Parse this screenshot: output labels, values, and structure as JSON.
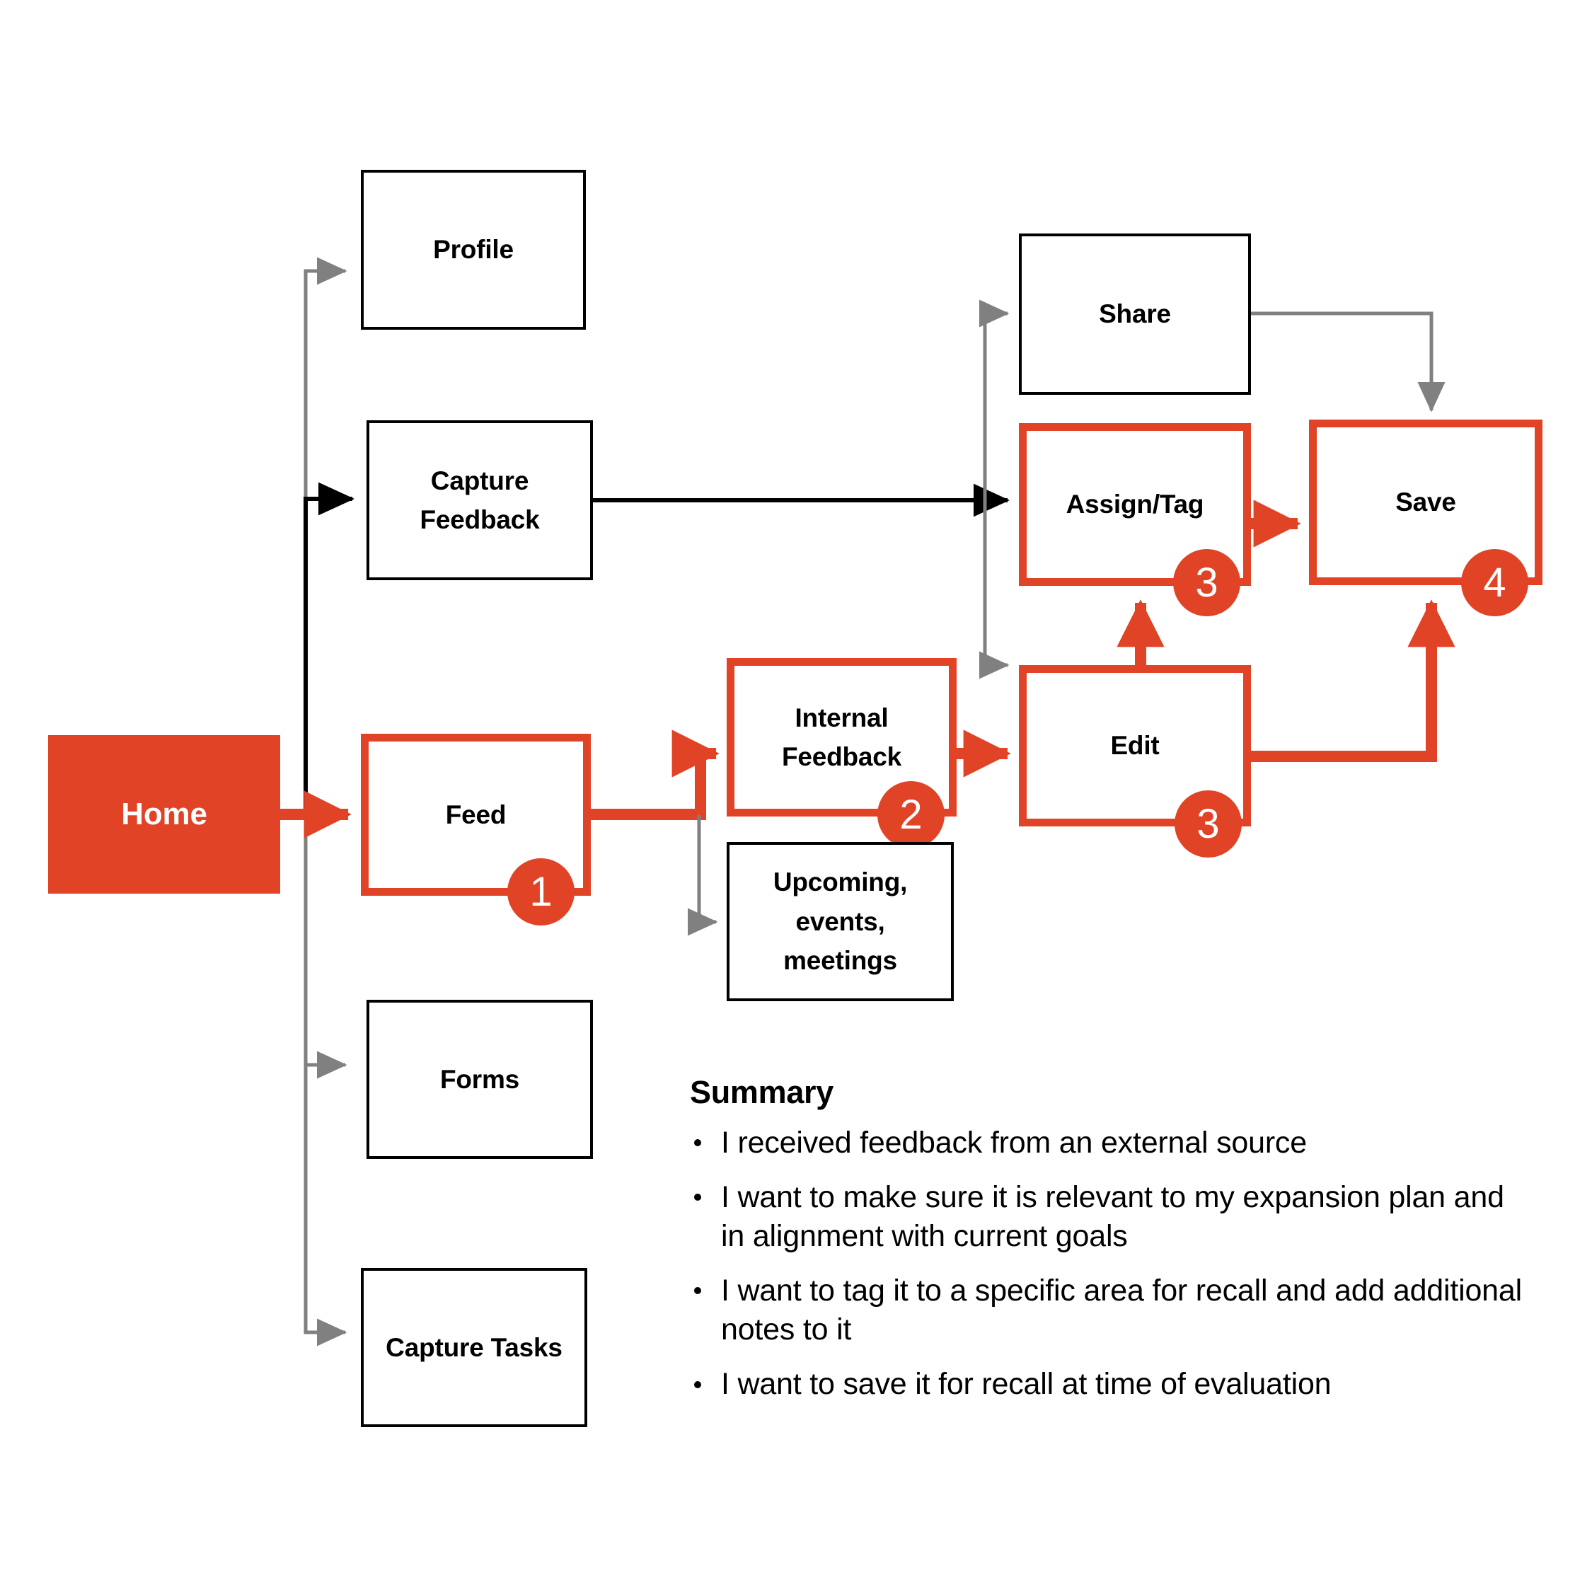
{
  "diagram": {
    "accent_color": "#E04326",
    "line_color_primary": "#000000",
    "line_color_secondary": "#808080",
    "nodes": [
      {
        "id": "home",
        "label": "Home",
        "style": "filled"
      },
      {
        "id": "profile",
        "label": "Profile",
        "style": "plain"
      },
      {
        "id": "capture-feedback",
        "label": "Capture\nFeedback",
        "style": "plain"
      },
      {
        "id": "feed",
        "label": "Feed",
        "style": "accent",
        "badge": "1"
      },
      {
        "id": "internal-feedback",
        "label": "Internal\nFeedback",
        "style": "accent",
        "badge": "2"
      },
      {
        "id": "upcoming",
        "label": "Upcoming,\nevents,\nmeetings",
        "style": "plain"
      },
      {
        "id": "forms",
        "label": "Forms",
        "style": "plain"
      },
      {
        "id": "capture-tasks",
        "label": "Capture Tasks",
        "style": "plain"
      },
      {
        "id": "share",
        "label": "Share",
        "style": "plain"
      },
      {
        "id": "assign-tag",
        "label": "Assign/Tag",
        "style": "accent",
        "badge": "3"
      },
      {
        "id": "edit",
        "label": "Edit",
        "style": "accent",
        "badge": "3"
      },
      {
        "id": "save",
        "label": "Save",
        "style": "accent",
        "badge": "4"
      }
    ]
  },
  "summary": {
    "heading": "Summary",
    "items": [
      "I received feedback from an external source",
      "I want to make sure it is relevant to my expansion plan and in alignment with current goals",
      "I want to tag it to a specific area for recall and add additional notes to it",
      "I want to save it for recall at time of evaluation"
    ]
  }
}
